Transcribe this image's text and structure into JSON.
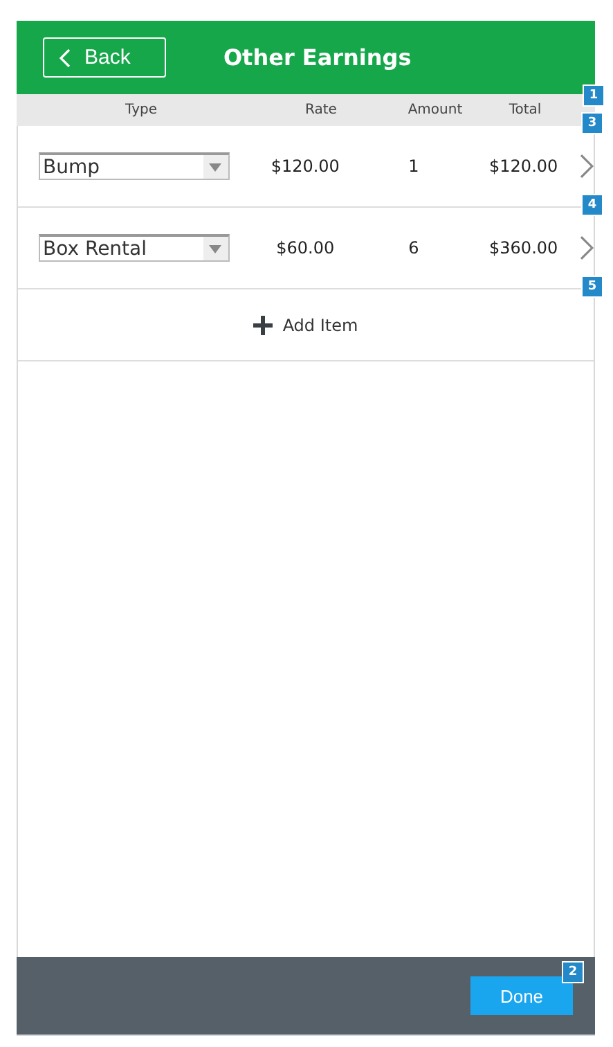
{
  "header": {
    "back_label": "Back",
    "title": "Other Earnings"
  },
  "column_header": {
    "marker": "1",
    "columns": [
      "Type",
      "Rate",
      "Amount",
      "Total"
    ]
  },
  "rows": [
    {
      "marker": "3",
      "type": "Bump",
      "rate": "$120.00",
      "amount": "1",
      "total": "$120.00"
    },
    {
      "marker": "4",
      "type": "Box Rental",
      "rate": "$60.00",
      "amount": "6",
      "total": "$360.00"
    }
  ],
  "add_item": {
    "marker": "5",
    "label": "Add Item"
  },
  "footer": {
    "marker": "2",
    "done_label": "Done"
  }
}
